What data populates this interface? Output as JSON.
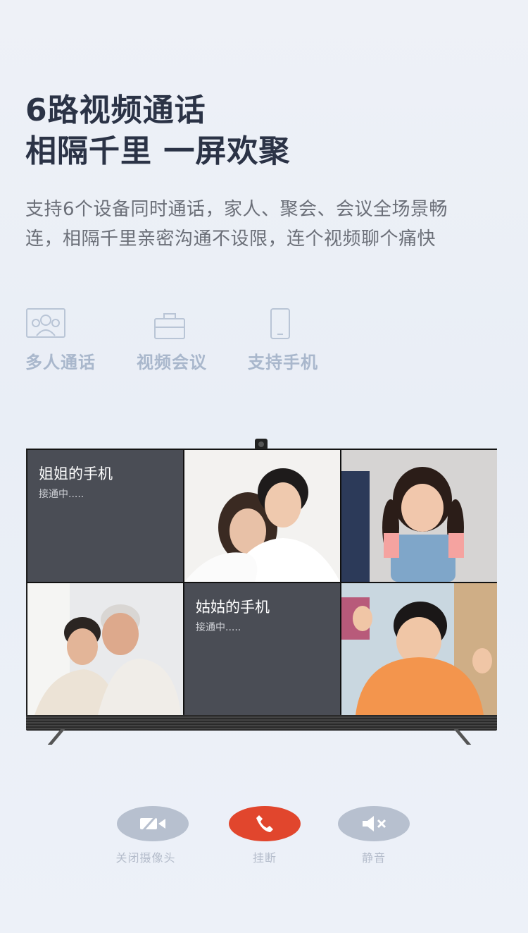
{
  "headline": {
    "line1": "6路视频通话",
    "line2": "相隔千里 一屏欢聚"
  },
  "description": "支持6个设备同时通话，家人、聚会、会议全场景畅连，相隔千里亲密沟通不设限，连个视频聊个痛快",
  "features": [
    {
      "icon": "people-icon",
      "label": "多人通话"
    },
    {
      "icon": "briefcase-icon",
      "label": "视频会议"
    },
    {
      "icon": "phone-icon",
      "label": "支持手机"
    }
  ],
  "tiles": [
    {
      "type": "calling",
      "name": "姐姐的手机",
      "status": "接通中....."
    },
    {
      "type": "video",
      "subject": "couple"
    },
    {
      "type": "video",
      "subject": "girl"
    },
    {
      "type": "video",
      "subject": "grandparents"
    },
    {
      "type": "calling",
      "name": "姑姑的手机",
      "status": "接通中....."
    },
    {
      "type": "video",
      "subject": "boy"
    }
  ],
  "controls": [
    {
      "icon": "camera-off-icon",
      "label": "关闭摄像头",
      "color": "#b7c0cf"
    },
    {
      "icon": "hang-up-icon",
      "label": "挂断",
      "color": "#e1462d"
    },
    {
      "icon": "mute-icon",
      "label": "静音",
      "color": "#b7c0cf"
    }
  ]
}
